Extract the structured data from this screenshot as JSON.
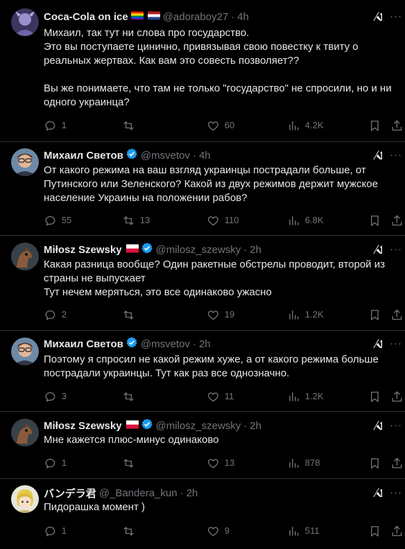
{
  "tweets": [
    {
      "name": "Coca-Cola on ice",
      "handle": "@adoraboy27",
      "time": "4h",
      "verified": false,
      "text": "Михаил, так тут ни слова про государство.\nЭто вы поступаете цинично, привязывая свою повестку к твиту о реальных жертвах. Как вам это совесть позволяет??\n\nВы же понимаете, что там не только \"государство\" не спросили, но и ни одного украинца?",
      "replies": "1",
      "reposts": "",
      "likes": "60",
      "views": "4.2K"
    },
    {
      "name": "Михаил Светов",
      "handle": "@msvetov",
      "time": "4h",
      "verified": true,
      "text": "От какого режима на ваш взгляд украинцы пострадали больше, от Путинского или Зеленского? Какой из двух режимов держит мужское население Украины на положении рабов?",
      "replies": "55",
      "reposts": "13",
      "likes": "110",
      "views": "6.8K"
    },
    {
      "name": "Miłosz Szewsky",
      "handle": "@milosz_szewsky",
      "time": "2h",
      "verified": true,
      "text": "Какая разница вообще? Один ракетные обстрелы проводит, второй из страны не выпускает\nТут нечем меряться, это все одинаково ужасно",
      "replies": "2",
      "reposts": "",
      "likes": "19",
      "views": "1.2K"
    },
    {
      "name": "Михаил Светов",
      "handle": "@msvetov",
      "time": "2h",
      "verified": true,
      "text": "Поэтому я спросил не какой режим хуже, а от какого режима больше пострадали украинцы. Тут как раз все однозначно.",
      "replies": "3",
      "reposts": "",
      "likes": "11",
      "views": "1.2K"
    },
    {
      "name": "Miłosz Szewsky",
      "handle": "@milosz_szewsky",
      "time": "2h",
      "verified": true,
      "text": "Мне кажется плюс-минус одинаково",
      "replies": "1",
      "reposts": "",
      "likes": "13",
      "views": "878"
    },
    {
      "name": "バンデラ君",
      "handle": "@_Bandera_kun",
      "time": "2h",
      "verified": false,
      "text": "Пидорашка момент )",
      "replies": "1",
      "reposts": "",
      "likes": "9",
      "views": "511"
    }
  ],
  "colors": {
    "background": "#000000",
    "text": "#e7e9ea",
    "muted": "#71767b",
    "verified": "#1d9bf0",
    "divider": "#2f3336"
  },
  "icons": [
    "reply-icon",
    "repost-icon",
    "like-icon",
    "views-icon",
    "bookmark-icon",
    "share-icon",
    "grok-icon",
    "more-icon",
    "verified-badge-icon",
    "rainbow-flag-icon",
    "netherlands-flag-icon",
    "poland-flag-icon"
  ]
}
